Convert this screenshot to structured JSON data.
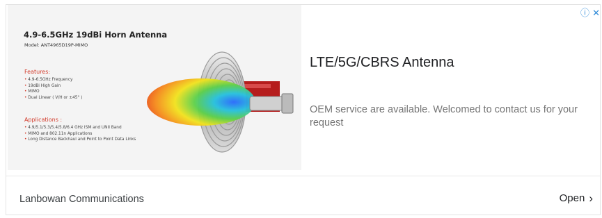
{
  "adchoices": {
    "label": "ⓘ ✕"
  },
  "creative": {
    "title": "4.9-6.5GHz 19dBi Horn Antenna",
    "model": "Model: ANT4965D19P-MIMO",
    "features_heading": "Features:",
    "features": [
      "4.9-6.5GHz Frequency",
      "19dBi High Gain",
      "MIMO",
      "Dual Linear ( V/H or ±45° )"
    ],
    "applications_heading": "Applications :",
    "applications": [
      "4.9/5.1/5.3/5.4/5.8/6.4 GHz ISM and UNII Band",
      "MIMO and 802.11n Applications",
      "Long Distance Backhaul and Point to Point Data Links"
    ]
  },
  "ad": {
    "headline": "LTE/5G/CBRS Antenna",
    "description": "OEM service are available. Welcomed to contact us for your request",
    "advertiser": "Lanbowan Communications",
    "cta": "Open",
    "cta_icon": "chevron-right-icon"
  }
}
